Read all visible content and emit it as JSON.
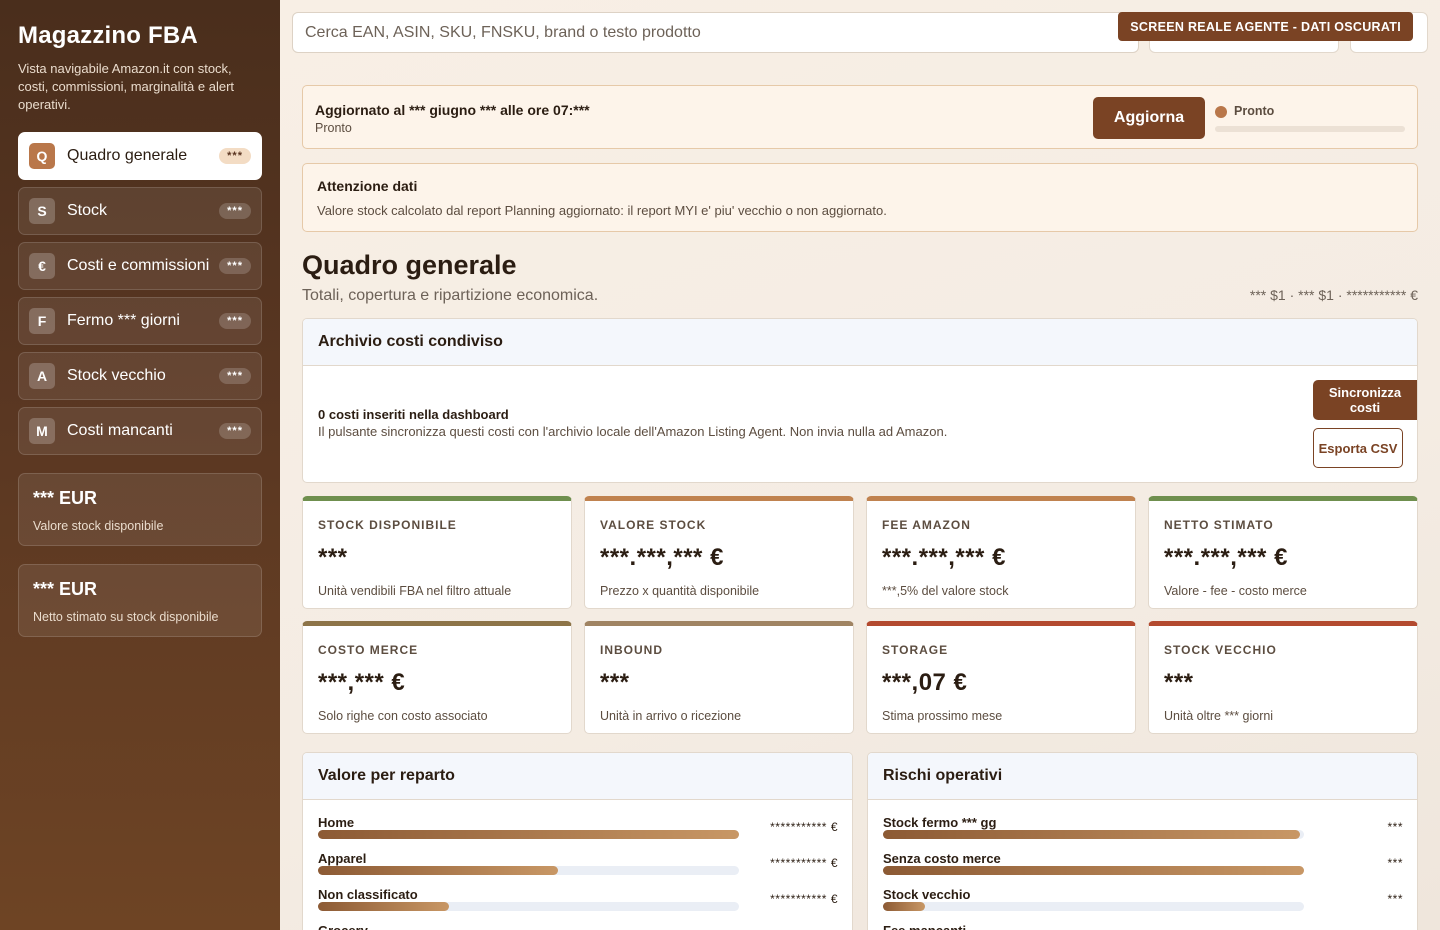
{
  "sidebar": {
    "title": "Magazzino FBA",
    "subtitle": "Vista navigabile Amazon.it con stock, costi, commissioni, marginalità e alert operativi.",
    "items": [
      {
        "letter": "Q",
        "label": "Quadro generale",
        "badge": "***",
        "active": true
      },
      {
        "letter": "S",
        "label": "Stock",
        "badge": "***",
        "active": false
      },
      {
        "letter": "€",
        "label": "Costi e commissioni",
        "badge": "***",
        "active": false
      },
      {
        "letter": "F",
        "label": "Fermo *** giorni",
        "badge": "***",
        "active": false
      },
      {
        "letter": "A",
        "label": "Stock vecchio",
        "badge": "***",
        "active": false
      },
      {
        "letter": "M",
        "label": "Costi mancanti",
        "badge": "***",
        "active": false
      }
    ],
    "cards": [
      {
        "value": "*** EUR",
        "label": "Valore stock disponibile"
      },
      {
        "value": "*** EUR",
        "label": "Netto stimato su stock disponibile"
      }
    ]
  },
  "topbar": {
    "search_placeholder": "Cerca EAN, ASIN, SKU, FNSKU, brand o testo prodotto",
    "agent_badge": "SCREEN REALE AGENTE - DATI OSCURATI"
  },
  "update": {
    "title": "Aggiornato al *** giugno *** alle ore 07:***",
    "subtitle": "Pronto",
    "button": "Aggiorna",
    "status": "Pronto",
    "progress": 0
  },
  "warning": {
    "title": "Attenzione dati",
    "text": "Valore stock calcolato dal report Planning aggiornato: il report MYI e' piu' vecchio o non aggiornato."
  },
  "page": {
    "title": "Quadro generale",
    "subtitle": "Totali, copertura e ripartizione economica.",
    "meta": "*** $1 · *** $1 · *********** €"
  },
  "archive": {
    "title": "Archivio costi condiviso",
    "line1": "0 costi inseriti nella dashboard",
    "line2": "Il pulsante sincronizza questi costi con l'archivio locale dell'Amazon Listing Agent. Non invia nulla ad Amazon.",
    "sync_button": "Sincronizza costi",
    "export_button": "Esporta CSV"
  },
  "kpis": [
    {
      "label": "STOCK DISPONIBILE",
      "value": "***",
      "note": "Unità vendibili FBA nel filtro attuale",
      "color": "#6f8f4e"
    },
    {
      "label": "VALORE STOCK",
      "value": "***.***,*** €",
      "note": "Prezzo x quantità disponibile",
      "color": "#c0824f"
    },
    {
      "label": "FEE AMAZON",
      "value": "***.***,*** €",
      "note": "***,5% del valore stock",
      "color": "#c0824f"
    },
    {
      "label": "NETTO STIMATO",
      "value": "***.***,*** €",
      "note": "Valore - fee - costo merce",
      "color": "#6f8f4e"
    },
    {
      "label": "COSTO MERCE",
      "value": "***,*** €",
      "note": "Solo righe con costo associato",
      "color": "#8d7448"
    },
    {
      "label": "INBOUND",
      "value": "***",
      "note": "Unità in arrivo o ricezione",
      "color": "#a08463"
    },
    {
      "label": "STORAGE",
      "value": "***,07 €",
      "note": "Stima prossimo mese",
      "color": "#b34a2f"
    },
    {
      "label": "STOCK VECCHIO",
      "value": "***",
      "note": "Unità oltre *** giorni",
      "color": "#b34a2f"
    }
  ],
  "reparto": {
    "title": "Valore per reparto",
    "rows": [
      {
        "label": "Home",
        "value": "*********** €",
        "fraction": 1.0
      },
      {
        "label": "Apparel",
        "value": "*********** €",
        "fraction": 0.57
      },
      {
        "label": "Non classificato",
        "value": "*********** €",
        "fraction": 0.31
      },
      {
        "label": "Grocery",
        "value": "",
        "fraction": 0.2
      }
    ]
  },
  "rischi": {
    "title": "Rischi operativi",
    "rows": [
      {
        "label": "Stock fermo *** gg",
        "value": "***",
        "fraction": 0.99
      },
      {
        "label": "Senza costo merce",
        "value": "***",
        "fraction": 1.0
      },
      {
        "label": "Stock vecchio",
        "value": "***",
        "fraction": 0.1
      },
      {
        "label": "Fee mancanti",
        "value": "",
        "fraction": 0.05
      }
    ]
  }
}
